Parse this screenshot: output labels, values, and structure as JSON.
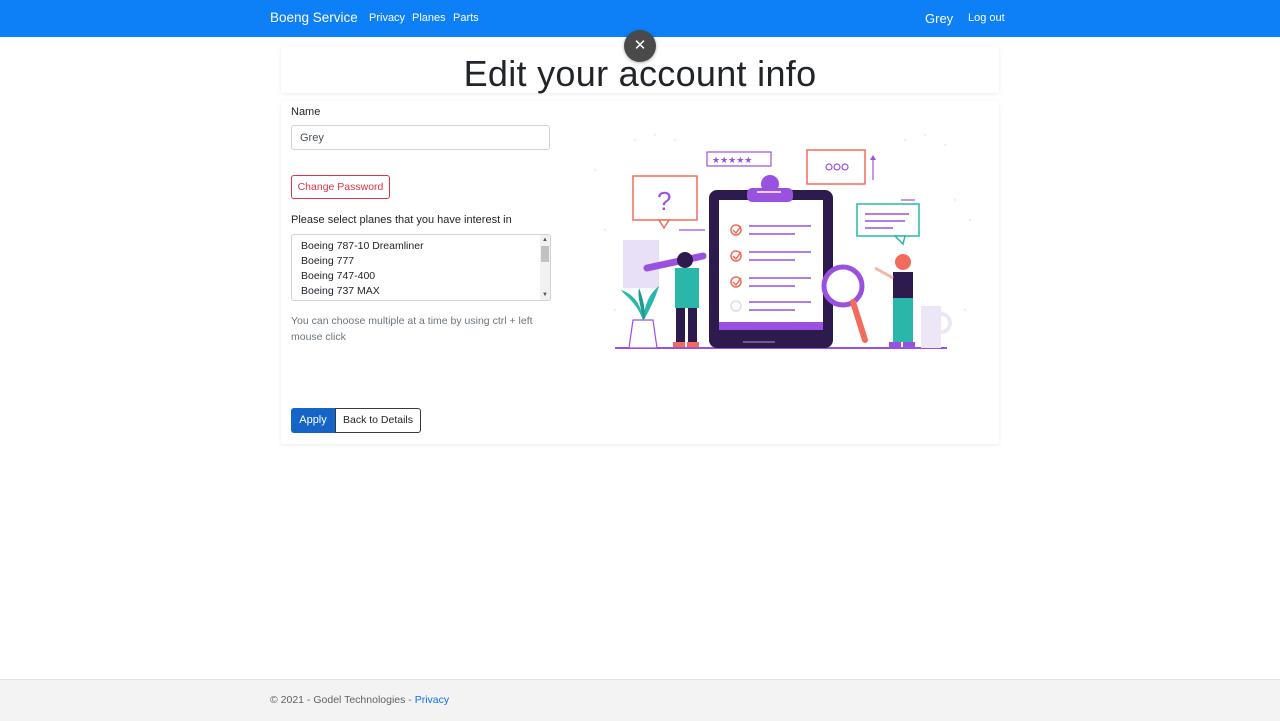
{
  "navbar": {
    "brand": "Boeng Service",
    "links": [
      "Privacy",
      "Planes",
      "Parts"
    ],
    "user": "Grey",
    "logout": "Log out"
  },
  "close_glyph": "✕",
  "title": "Edit your account info",
  "form": {
    "name_label": "Name",
    "name_value": "Grey",
    "change_password": "Change Password",
    "planes_label": "Please select planes that you have interest in",
    "plane_options": [
      "Boeing 787-10 Dreamliner",
      "Boeing 777",
      "Boeing 747-400",
      "Boeing 737 MAX"
    ],
    "hint": "You can choose multiple at a time by using ctrl + left mouse click",
    "apply": "Apply",
    "back": "Back to Details"
  },
  "footer": {
    "text": "© 2021 - Godel Technologies - ",
    "link": "Privacy"
  },
  "colors": {
    "navbar": "#0d7ff7",
    "primary": "#1565c9",
    "danger": "#dc3545",
    "illustration_accent": "#9b51e0",
    "illustration_dark": "#2d1b4e",
    "illustration_teal": "#2ab7a9",
    "illustration_coral": "#f26b5b"
  }
}
